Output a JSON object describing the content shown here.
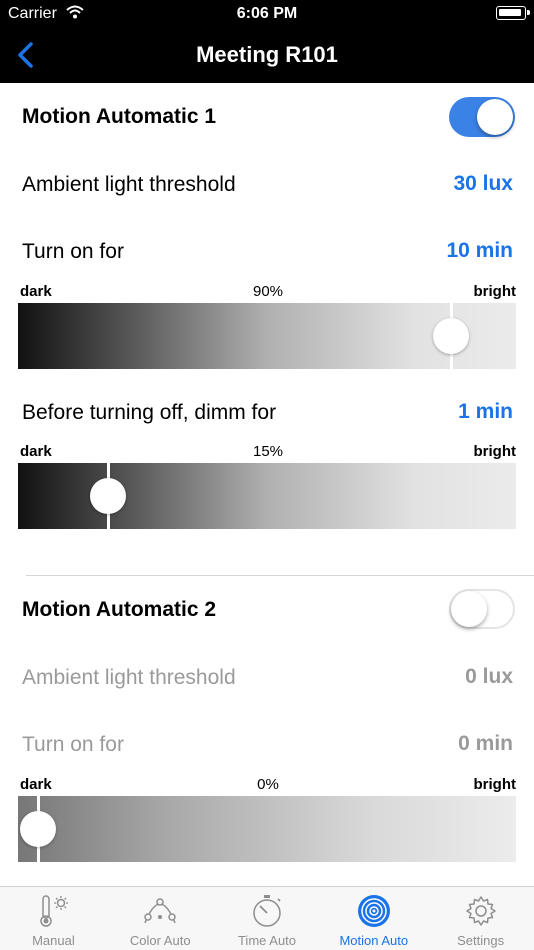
{
  "status": {
    "carrier": "Carrier",
    "time": "6:06 PM"
  },
  "nav": {
    "title": "Meeting R101"
  },
  "motion1": {
    "title": "Motion Automatic 1",
    "enabled": true,
    "threshold_label": "Ambient light threshold",
    "threshold_value": "30 lux",
    "turn_on_label": "Turn on for",
    "turn_on_value": "10 min",
    "slider1": {
      "dark": "dark",
      "percent": "90%",
      "bright": "bright",
      "level": 0.87
    },
    "dimm_label": "Before turning off, dimm for",
    "dimm_value": "1 min",
    "slider2": {
      "dark": "dark",
      "percent": "15%",
      "bright": "bright",
      "level": 0.18
    }
  },
  "motion2": {
    "title": "Motion Automatic 2",
    "enabled": false,
    "threshold_label": "Ambient light threshold",
    "threshold_value": "0 lux",
    "turn_on_label": "Turn on for",
    "turn_on_value": "0 min",
    "slider1": {
      "dark": "dark",
      "percent": "0%",
      "bright": "bright",
      "level": 0.04
    }
  },
  "tabs": [
    {
      "label": "Manual",
      "icon": "thermometer-sun-icon"
    },
    {
      "label": "Color Auto",
      "icon": "color-curve-icon"
    },
    {
      "label": "Time Auto",
      "icon": "stopwatch-icon"
    },
    {
      "label": "Motion Auto",
      "icon": "motion-sensor-icon",
      "active": true
    },
    {
      "label": "Settings",
      "icon": "gear-icon"
    }
  ],
  "colors": {
    "accent": "#1a73e8",
    "toggle_on": "#3b82e6",
    "disabled_text": "#9a9a9a"
  }
}
